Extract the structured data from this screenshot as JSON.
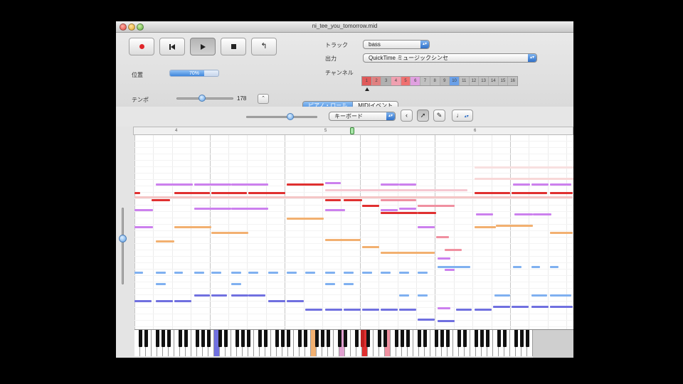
{
  "window": {
    "title": "ni_tee_you_tomorrow.mid"
  },
  "transport": {
    "buttons": [
      {
        "name": "record",
        "icon": "record-icon"
      },
      {
        "name": "rewind",
        "icon": "skip-back-icon"
      },
      {
        "name": "play",
        "icon": "play-icon",
        "pressed": true
      },
      {
        "name": "stop",
        "icon": "stop-icon"
      },
      {
        "name": "loop",
        "icon": "loop-icon",
        "glyph": "↰"
      }
    ]
  },
  "position": {
    "label": "位置",
    "value_text": "70%",
    "fraction": 0.7
  },
  "tempo": {
    "label": "テンポ",
    "value": "178",
    "stepper_glyph": "⌃",
    "slider_fraction": 0.45
  },
  "track": {
    "label": "トラック",
    "value": "bass"
  },
  "output": {
    "label": "出力",
    "value": "QuickTime ミュージックシンセ"
  },
  "channel": {
    "label": "チャンネル",
    "cells": [
      "1",
      "2",
      "3",
      "4",
      "5",
      "6",
      "7",
      "8",
      "9",
      "10",
      "11",
      "12",
      "13",
      "14",
      "15",
      "16"
    ],
    "cell_colors": [
      "#e05a5a",
      "#e08080",
      "#b0b0b0",
      "#f0a0b0",
      "#f07070",
      "#e0a0e0",
      "#c0c0c0",
      "#c0c0c0",
      "#b8b8b8",
      "#6aa0e8",
      "#c0c0c0",
      "#c0c0c0",
      "#c0c0c0",
      "#c0c0c0",
      "#c0c0c0",
      "#c0c0c0"
    ]
  },
  "view_tabs": [
    {
      "label": "ピアノ・ロール",
      "active": true
    },
    {
      "label": "MIDIイベント",
      "active": false
    }
  ],
  "editor": {
    "zoom_fraction": 0.62,
    "input_mode": {
      "value": "キーボード"
    },
    "tools": [
      {
        "name": "tool-back",
        "glyph": "‹",
        "selected": false
      },
      {
        "name": "tool-arrow",
        "glyph": "➚",
        "selected": true
      },
      {
        "name": "tool-pencil",
        "glyph": "✎",
        "selected": false
      },
      {
        "name": "tool-note-length",
        "glyph": "♩",
        "selected": false
      }
    ]
  },
  "colors": {
    "accent": "#3f86dc",
    "bass": "#7070e0",
    "lead": "#e03030",
    "chord": "#cc80ee",
    "light_blue": "#7fb0f0",
    "orange": "#f2b070",
    "pink": "#f090a0"
  }
}
